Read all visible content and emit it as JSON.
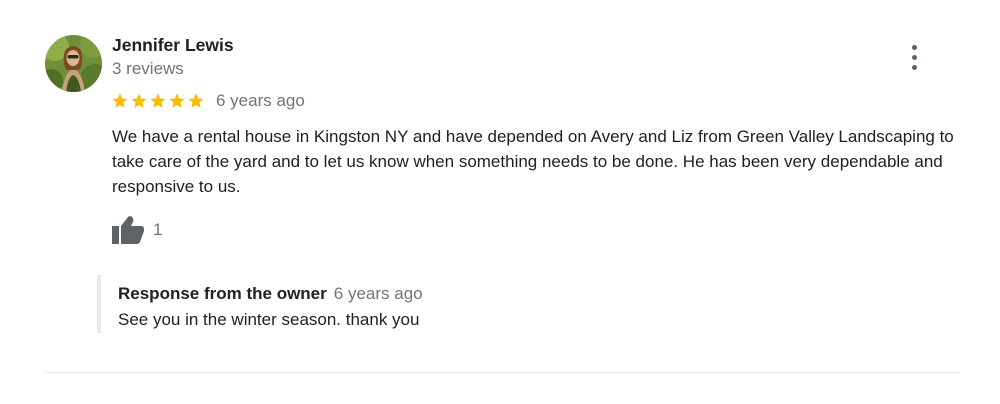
{
  "reviewer": {
    "name": "Jennifer Lewis",
    "review_count": "3 reviews",
    "avatar_icon": "reviewer-photo"
  },
  "review": {
    "rating": 5,
    "rating_max": 5,
    "date": "6 years ago",
    "text": "We have a rental house in Kingston NY and have depended on Avery and Liz from Green Valley Landscaping to take care of the yard and to let us know when something needs to be done. He has been very dependable and responsive to us.",
    "likes": "1",
    "like_icon": "thumbs-up-icon",
    "menu_icon": "more-vert-icon"
  },
  "owner_response": {
    "label": "Response from the owner",
    "date": "6 years ago",
    "text": "See you in the winter season. thank you"
  },
  "colors": {
    "star": "#fbbc04",
    "secondary_text": "#70757a",
    "primary_text": "#202124",
    "icon": "#5f6368",
    "divider": "#e8eaed"
  }
}
